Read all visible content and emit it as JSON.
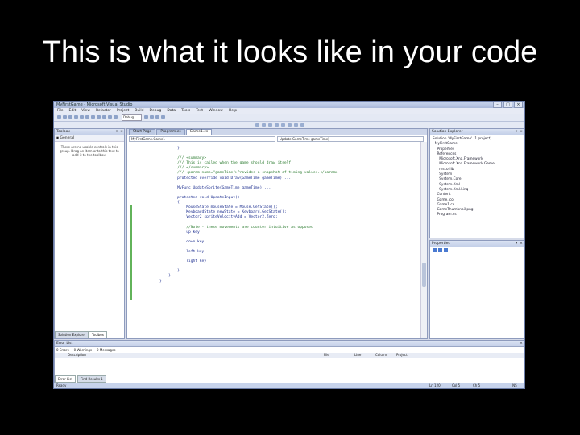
{
  "slide": {
    "title": "This is what it looks like in your code"
  },
  "window": {
    "title": "MyFirstGame - Microsoft Visual Studio",
    "menu": [
      "File",
      "Edit",
      "View",
      "Refactor",
      "Project",
      "Build",
      "Debug",
      "Data",
      "Tools",
      "Test",
      "Window",
      "Help"
    ],
    "config_select": "Debug"
  },
  "toolbox": {
    "title": "Toolbox",
    "group": "General",
    "message": "There are no usable controls in this group. Drag an item onto this text to add it to the toolbox.",
    "tabs": [
      "Solution Explorer",
      "Toolbox"
    ]
  },
  "editor": {
    "tabs": [
      "Start Page",
      "Program.cs",
      "Game1.cs"
    ],
    "nav_left": "MyFirstGame.Game1",
    "nav_right": "Update(GameTime gameTime)",
    "code_lines": [
      "        }",
      "",
      "        /// <summary>",
      "        /// This is called when the game should draw itself.",
      "        /// </summary>",
      "        /// <param name=\"gameTime\">Provides a snapshot of timing values.</param>",
      "        protected override void Draw(GameTime gameTime) ...",
      "",
      "        MyFunc UpdateSprite(GameTime gameTime) ...",
      "",
      "        protected void UpdateInput()",
      "        {",
      "            MouseState mouseState = Mouse.GetState();",
      "            KeyboardState newState = Keyboard.GetState();",
      "            Vector2 spriteVelocityAdd = Vector2.Zero;",
      "",
      "            //Note - these movements are counter intuitive as opposed",
      "            up key",
      "",
      "            down key",
      "",
      "            left key",
      "",
      "            right key",
      "",
      "        }",
      "    }",
      "}"
    ]
  },
  "solution_explorer": {
    "title": "Solution Explorer",
    "items": [
      "Solution 'MyFirstGame' (1 project)",
      "  MyFirstGame",
      "    Properties",
      "    References",
      "      Microsoft.Xna.Framework",
      "      Microsoft.Xna.Framework.Game",
      "      mscorlib",
      "      System",
      "      System.Core",
      "      System.Xml",
      "      System.Xml.Linq",
      "    Content",
      "    Game.ico",
      "    Game1.cs",
      "    GameThumbnail.png",
      "    Program.cs"
    ]
  },
  "properties": {
    "title": "Properties"
  },
  "error_list": {
    "title": "Error List",
    "tabs": [
      "0 Errors",
      "0 Warnings",
      "0 Messages"
    ],
    "columns": [
      "Description",
      "File",
      "Line",
      "Column",
      "Project"
    ],
    "bottom_tabs": [
      "Error List",
      "Find Results 1"
    ]
  },
  "status": {
    "left": "Ready",
    "ln": "Ln 120",
    "col": "Col 5",
    "ch": "Ch 5",
    "mode": "INS"
  }
}
